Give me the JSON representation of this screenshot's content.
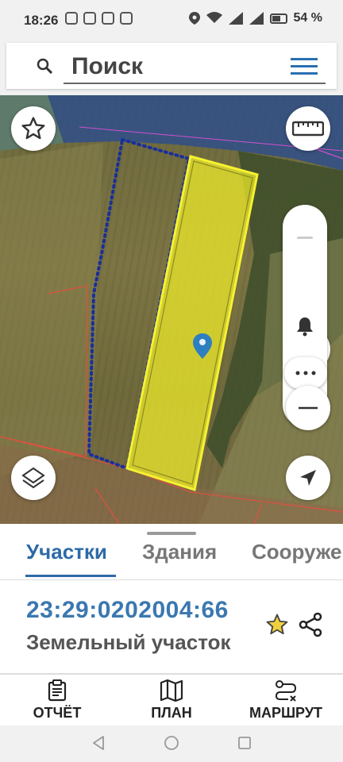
{
  "status_bar": {
    "time": "18:26",
    "battery": "54 %"
  },
  "search": {
    "placeholder": "Поиск"
  },
  "map": {
    "selected_parcel_color": "#f2f02a",
    "parcel_outline_color": "#1a2f9a",
    "boundary_color": "#e05040",
    "buttons": [
      "star-icon",
      "ruler-icon",
      "bell-icon",
      "more-icon",
      "zoom-out-icon",
      "layers-icon",
      "navigation-icon"
    ]
  },
  "tabs": {
    "items": [
      "Участки",
      "Здания",
      "Сооружения"
    ],
    "active": "Участки",
    "accent": "#2d6aa8"
  },
  "result": {
    "cadastral_number": "23:29:0202004:66",
    "type": "Земельный участок"
  },
  "bottom_nav": {
    "report": "ОТЧЁТ",
    "plan": "ПЛАН",
    "route": "МАРШРУТ"
  }
}
